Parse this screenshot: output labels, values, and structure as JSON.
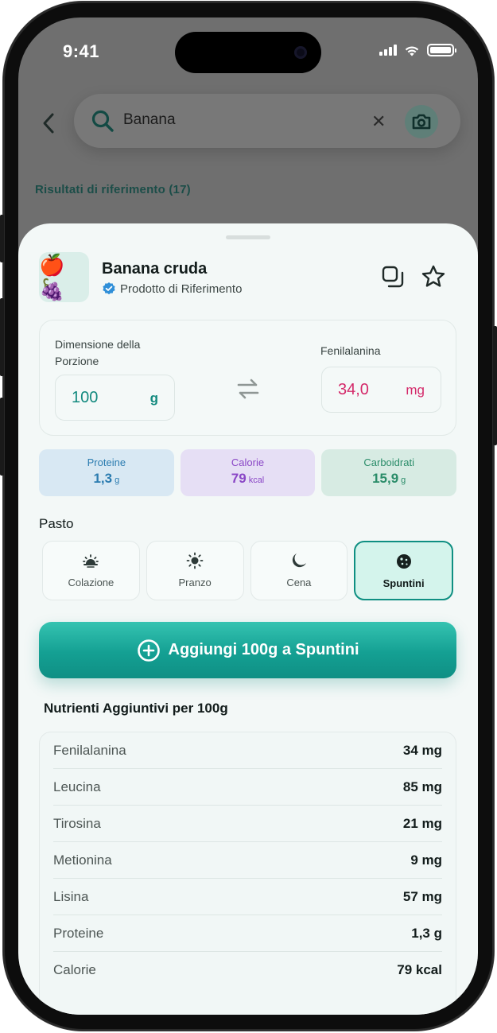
{
  "status_bar": {
    "time": "9:41"
  },
  "search": {
    "query": "Banana"
  },
  "results": {
    "label": "Risultati di riferimento (17)"
  },
  "food": {
    "emoji": "🍎🍇",
    "title": "Banana cruda",
    "source_label": "Prodotto di Riferimento"
  },
  "portion": {
    "label": "Dimensione della Porzione",
    "value": "100",
    "unit": "g",
    "phe_label": "Fenilalanina",
    "phe_value": "34,0",
    "phe_unit": "mg"
  },
  "macros": [
    {
      "name": "Proteine",
      "value": "1,3",
      "unit": "g"
    },
    {
      "name": "Calorie",
      "value": "79",
      "unit": "kcal"
    },
    {
      "name": "Carboidrati",
      "value": "15,9",
      "unit": "g"
    }
  ],
  "meal": {
    "label": "Pasto",
    "options": [
      {
        "name": "Colazione",
        "icon": "sunrise-icon"
      },
      {
        "name": "Pranzo",
        "icon": "sun-icon"
      },
      {
        "name": "Cena",
        "icon": "moon-icon"
      },
      {
        "name": "Spuntini",
        "icon": "cookie-icon"
      }
    ],
    "selected": "Spuntini"
  },
  "add_button": {
    "label": "Aggiungi 100g a Spuntini"
  },
  "nutrients": {
    "title": "Nutrienti Aggiuntivi per 100g",
    "rows": [
      {
        "name": "Fenilalanina",
        "value": "34 mg"
      },
      {
        "name": "Leucina",
        "value": "85 mg"
      },
      {
        "name": "Tirosina",
        "value": "21 mg"
      },
      {
        "name": "Metionina",
        "value": "9 mg"
      },
      {
        "name": "Lisina",
        "value": "57 mg"
      },
      {
        "name": "Proteine",
        "value": "1,3 g"
      },
      {
        "name": "Calorie",
        "value": "79 kcal"
      }
    ]
  },
  "colors": {
    "accent": "#14a093",
    "phe": "#d42a6a",
    "protein": "#2b7cb0",
    "calorie": "#8a47c6",
    "carb": "#2a8c69"
  }
}
